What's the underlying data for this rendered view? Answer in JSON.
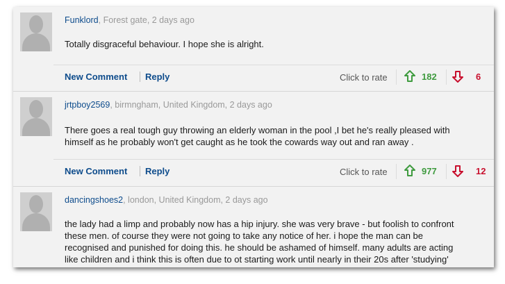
{
  "comments": [
    {
      "user": "Funklord",
      "location": ", Forest gate, 2 days ago",
      "text": "Totally disgraceful behaviour. I hope she is alright.",
      "new_comment": "New Comment",
      "reply": "Reply",
      "click_to_rate": "Click to rate",
      "up_votes": "182",
      "down_votes": "6"
    },
    {
      "user": "jrtpboy2569",
      "location": ", birmngham, United Kingdom, 2 days ago",
      "text_lines": [
        "There goes a real tough guy throwing an elderly woman in the pool ,I bet he's really pleased with",
        "himself as he probably won't get caught as he took the cowards way out and ran away ."
      ],
      "new_comment": "New Comment",
      "reply": "Reply",
      "click_to_rate": "Click to rate",
      "up_votes": "977",
      "down_votes": "12"
    },
    {
      "user": "dancingshoes2",
      "location": ", london, United Kingdom, 2 days ago",
      "text_lines": [
        "the lady had a limp and probably now has a hip injury. she was very brave - but foolish to confront",
        "these men. of course they were not going to take any notice of her. i hope the man can be",
        "recognised and punished for doing this. he should be ashamed of himself. many adults are acting",
        "like children and i think this is often due to ot starting work until nearly in their 20s after 'studying'"
      ]
    }
  ],
  "colors": {
    "up": "#3f9b3f",
    "down": "#c8102e",
    "link": "#0e4c8c"
  },
  "icons": {
    "up": "arrow-up-outline-icon",
    "down": "arrow-down-outline-icon",
    "avatar": "default-avatar-icon"
  }
}
